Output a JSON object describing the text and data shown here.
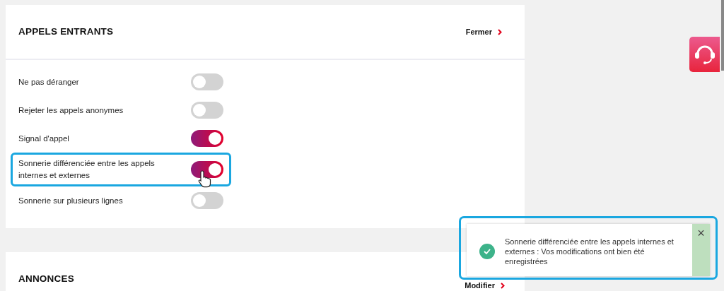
{
  "section": {
    "title": "APPELS ENTRANTS",
    "close_link": "Fermer"
  },
  "settings": [
    {
      "label": "Ne pas déranger",
      "on": false,
      "highlighted": false,
      "pointer": false
    },
    {
      "label": "Rejeter les appels anonymes",
      "on": false,
      "highlighted": false,
      "pointer": false
    },
    {
      "label": "Signal d'appel",
      "on": true,
      "highlighted": false,
      "pointer": false
    },
    {
      "label": "Sonnerie différenciée entre les appels internes et externes",
      "on": true,
      "highlighted": true,
      "pointer": true
    },
    {
      "label": "Sonnerie sur plusieurs lignes",
      "on": false,
      "highlighted": false,
      "pointer": false
    }
  ],
  "section_2": {
    "title": "ANNONCES",
    "edit_link": "Modifier"
  },
  "toast": {
    "message": "Sonnerie différenciée entre les appels internes et externes : Vos modifications ont bien été enregistrées",
    "highlighted": true,
    "close": "×"
  }
}
